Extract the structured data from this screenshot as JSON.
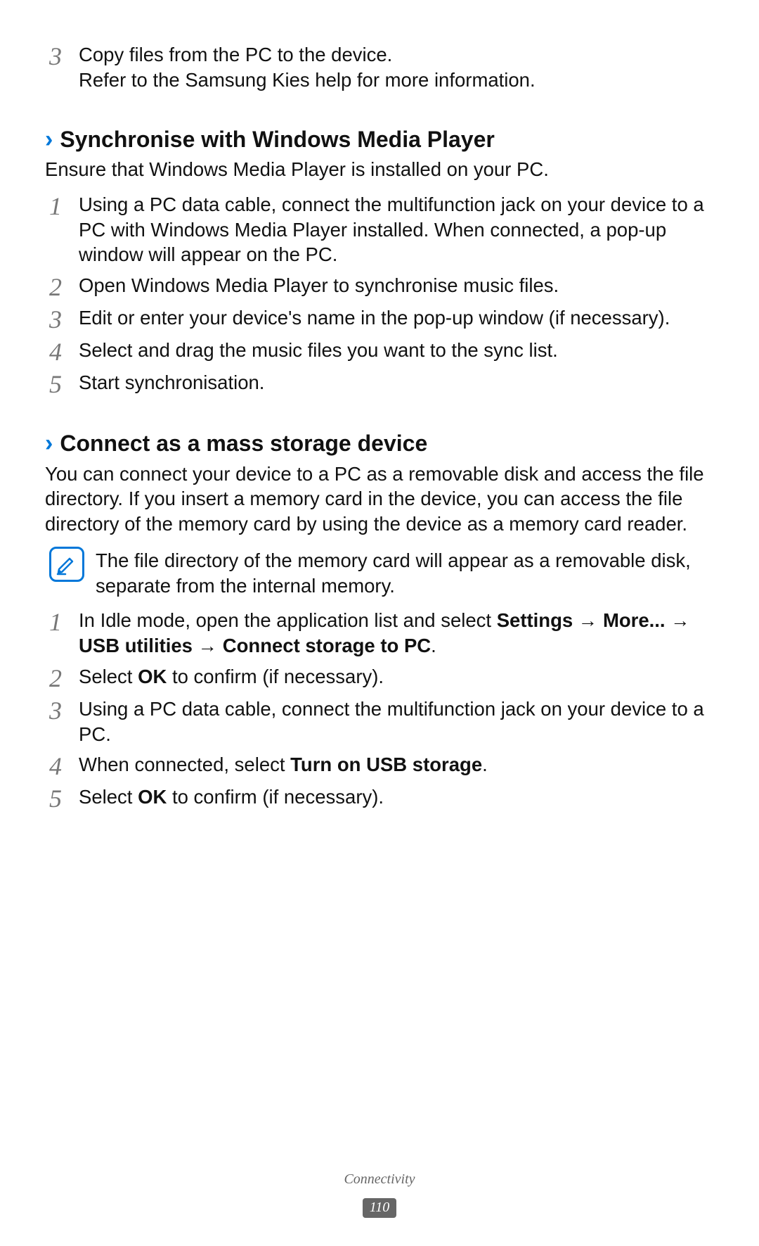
{
  "top_step": {
    "num": "3",
    "line1": "Copy files from the PC to the device.",
    "line2": "Refer to the Samsung Kies help for more information."
  },
  "section_wmp": {
    "title": "Synchronise with Windows Media Player",
    "intro": "Ensure that Windows Media Player is installed on your PC.",
    "steps": [
      {
        "num": "1",
        "text": "Using a PC data cable, connect the multifunction jack on your device to a PC with Windows Media Player installed. When connected, a pop-up window will appear on the PC."
      },
      {
        "num": "2",
        "text": "Open Windows Media Player to synchronise music files."
      },
      {
        "num": "3",
        "text": "Edit or enter your device's name in the pop-up window (if necessary)."
      },
      {
        "num": "4",
        "text": "Select and drag the music files you want to the sync list."
      },
      {
        "num": "5",
        "text": "Start synchronisation."
      }
    ]
  },
  "section_mass": {
    "title": "Connect as a mass storage device",
    "intro": "You can connect your device to a PC as a removable disk and access the file directory. If you insert a memory card in the device, you can access the file directory of the memory card by using the device as a memory card reader.",
    "note": "The file directory of the memory card will appear as a removable disk, separate from the internal memory.",
    "steps": {
      "s1": {
        "num": "1",
        "pre": "In Idle mode, open the application list and select ",
        "b1": "Settings",
        "arrow1": " → ",
        "b2": "More...",
        "arrow2": " → ",
        "b3": "USB utilities",
        "arrow3": " → ",
        "b4": "Connect storage to PC",
        "post": "."
      },
      "s2": {
        "num": "2",
        "pre": "Select ",
        "b1": "OK",
        "post": " to confirm (if necessary)."
      },
      "s3": {
        "num": "3",
        "text": "Using a PC data cable, connect the multifunction jack on your device to a PC."
      },
      "s4": {
        "num": "4",
        "pre": "When connected, select ",
        "b1": "Turn on USB storage",
        "post": "."
      },
      "s5": {
        "num": "5",
        "pre": "Select ",
        "b1": "OK",
        "post": " to confirm (if necessary)."
      }
    }
  },
  "footer": {
    "section": "Connectivity",
    "page": "110"
  }
}
